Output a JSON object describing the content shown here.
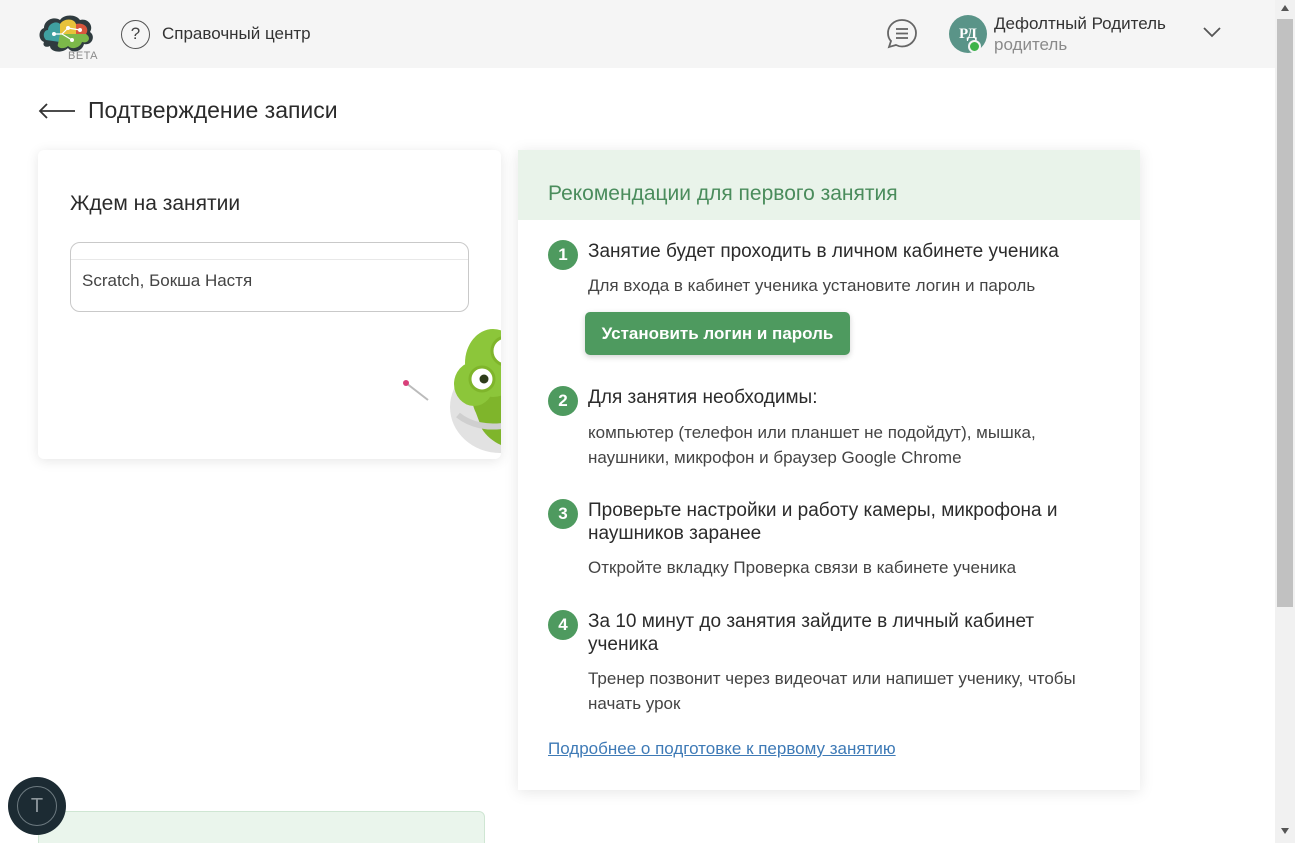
{
  "header": {
    "beta_label": "BETA",
    "help_icon_glyph": "?",
    "help_label": "Справочный центр",
    "user": {
      "initials": "РД",
      "name": "Дефолтный Родитель",
      "role": "родитель",
      "avatar_color": "#5a9488",
      "status_color": "#3db34a"
    },
    "icons": [
      "brain-logo-icon",
      "help-icon",
      "chat-icon",
      "chevron-down-icon"
    ]
  },
  "page": {
    "back_icon": "arrow-left-icon",
    "title": "Подтверждение записи"
  },
  "left_card": {
    "title": "Ждем на занятии",
    "course": "Scratch, Бокша Настя"
  },
  "recommendations": {
    "title": "Рекомендации для первого занятия",
    "steps": [
      {
        "num": "1",
        "title": "Занятие будет проходить в личном кабинете ученика",
        "desc": "Для входа в кабинет ученика установите логин и пароль",
        "button": "Установить логин и пароль"
      },
      {
        "num": "2",
        "title": "Для занятия необходимы:",
        "desc_line1": "компьютер (телефон или планшет не подойдут), мышка,",
        "desc_line2": "наушники, микрофон и браузер Google Chrome"
      },
      {
        "num": "3",
        "title_line1": "Проверьте настройки и работу камеры, микрофона и",
        "title_line2": "наушников заранее",
        "desc": "Откройте вкладку Проверка связи в кабинете ученика"
      },
      {
        "num": "4",
        "title_line1": "За 10 минут до занятия зайдите в личный кабинет",
        "title_line2": "ученика",
        "desc_line1": "Тренер позвонит через видеочат или напишет ученику, чтобы",
        "desc_line2": "начать урок"
      }
    ],
    "more_link": "Подробнее о подготовке к первому занятию"
  },
  "floating_button": {
    "glyph": "T"
  },
  "colors": {
    "accent_green": "#4e9a5f",
    "header_green_bg": "#e9f3ea",
    "title_green": "#4a8c5c",
    "link_blue": "#3e7ab6"
  }
}
